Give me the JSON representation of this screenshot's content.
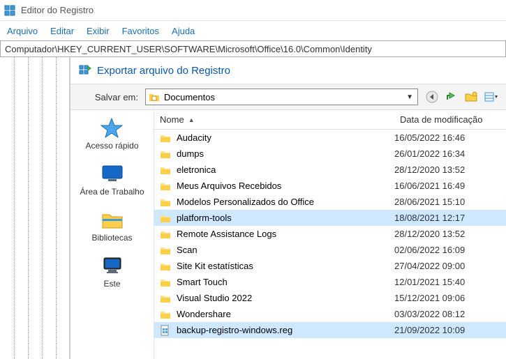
{
  "window": {
    "title": "Editor do Registro"
  },
  "menu": {
    "items": [
      "Arquivo",
      "Editar",
      "Exibir",
      "Favoritos",
      "Ajuda"
    ]
  },
  "address": {
    "path": "Computador\\HKEY_CURRENT_USER\\SOFTWARE\\Microsoft\\Office\\16.0\\Common\\Identity"
  },
  "dialog": {
    "title": "Exportar arquivo do Registro",
    "save_in_label": "Salvar em:",
    "save_in_value": "Documentos",
    "places": {
      "quick": "Acesso rápido",
      "desktop": "Área de Trabalho",
      "libraries": "Bibliotecas",
      "thispc": "Este"
    },
    "columns": {
      "name": "Nome",
      "date": "Data de modificação"
    },
    "files": [
      {
        "name": "Audacity",
        "date": "16/05/2022 16:46",
        "type": "folder",
        "selected": false
      },
      {
        "name": "dumps",
        "date": "26/01/2022 16:34",
        "type": "folder",
        "selected": false
      },
      {
        "name": "eletronica",
        "date": "28/12/2020 13:52",
        "type": "folder",
        "selected": false
      },
      {
        "name": "Meus Arquivos Recebidos",
        "date": "16/06/2021 16:49",
        "type": "folder",
        "selected": false
      },
      {
        "name": "Modelos Personalizados do Office",
        "date": "28/06/2021 15:10",
        "type": "folder",
        "selected": false
      },
      {
        "name": "platform-tools",
        "date": "18/08/2021 12:17",
        "type": "folder",
        "selected": true
      },
      {
        "name": "Remote Assistance Logs",
        "date": "28/12/2020 13:52",
        "type": "folder",
        "selected": false
      },
      {
        "name": "Scan",
        "date": "02/06/2022 16:09",
        "type": "folder",
        "selected": false
      },
      {
        "name": "Site Kit estatísticas",
        "date": "27/04/2022 09:00",
        "type": "folder",
        "selected": false
      },
      {
        "name": "Smart Touch",
        "date": "12/01/2021 15:40",
        "type": "folder",
        "selected": false
      },
      {
        "name": "Visual Studio 2022",
        "date": "15/12/2021 09:06",
        "type": "folder",
        "selected": false
      },
      {
        "name": "Wondershare",
        "date": "03/03/2022 08:12",
        "type": "folder",
        "selected": false
      },
      {
        "name": "backup-registro-windows.reg",
        "date": "21/09/2022 10:09",
        "type": "reg",
        "selected": true
      }
    ]
  }
}
